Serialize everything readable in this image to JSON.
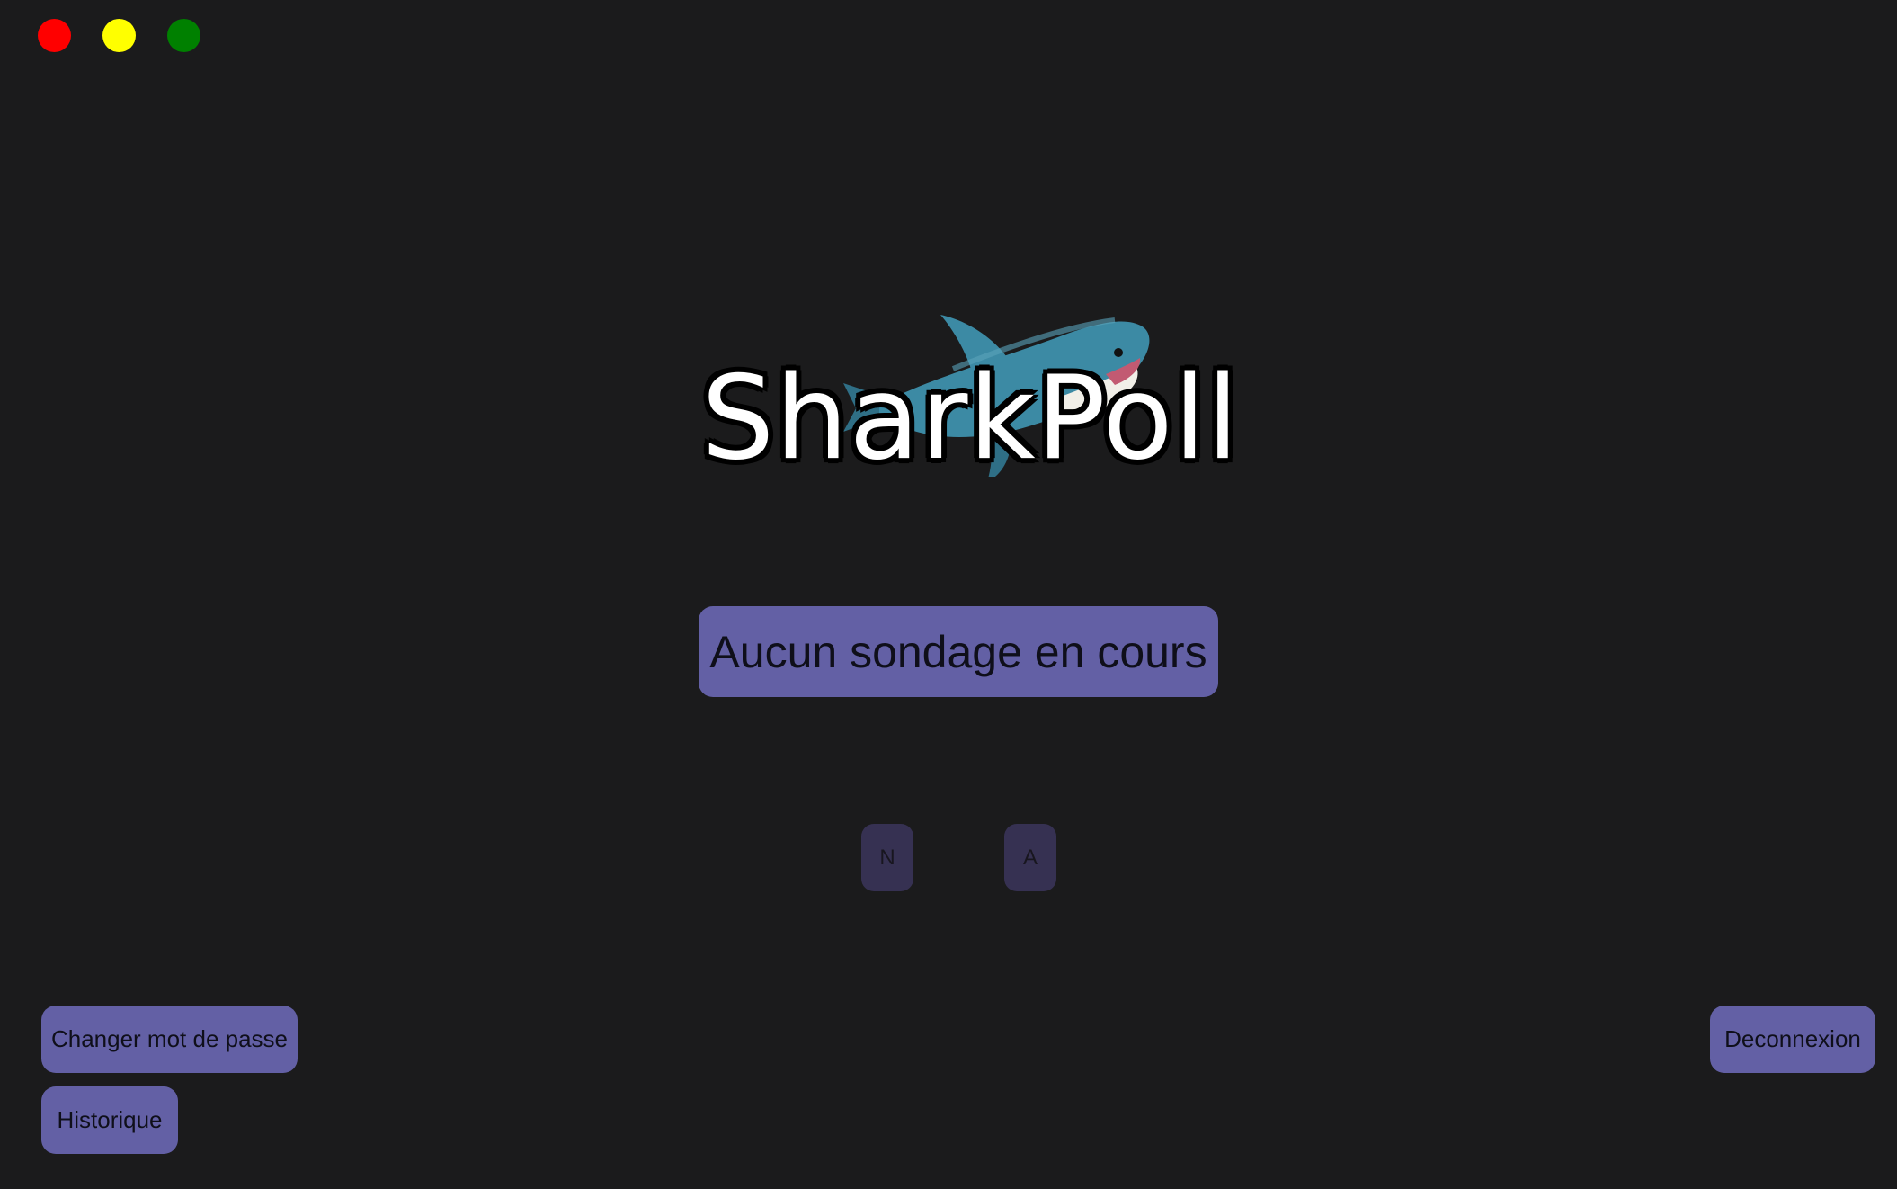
{
  "window": {
    "controls": [
      "close",
      "minimize",
      "maximize"
    ]
  },
  "header": {
    "title": "SharkPoll",
    "mascot": "shark-plush-image"
  },
  "main": {
    "status": "Aucun sondage en cours",
    "keys": [
      "N",
      "A"
    ]
  },
  "footer": {
    "change_password": "Changer mot de passe",
    "history": "Historique",
    "logout": "Deconnexion"
  },
  "colors": {
    "background": "#1b1b1c",
    "accent": "#6360a5",
    "accent_dim": "#363152",
    "close": "#ff0000",
    "minimize": "#ffff00",
    "maximize": "#008000"
  }
}
